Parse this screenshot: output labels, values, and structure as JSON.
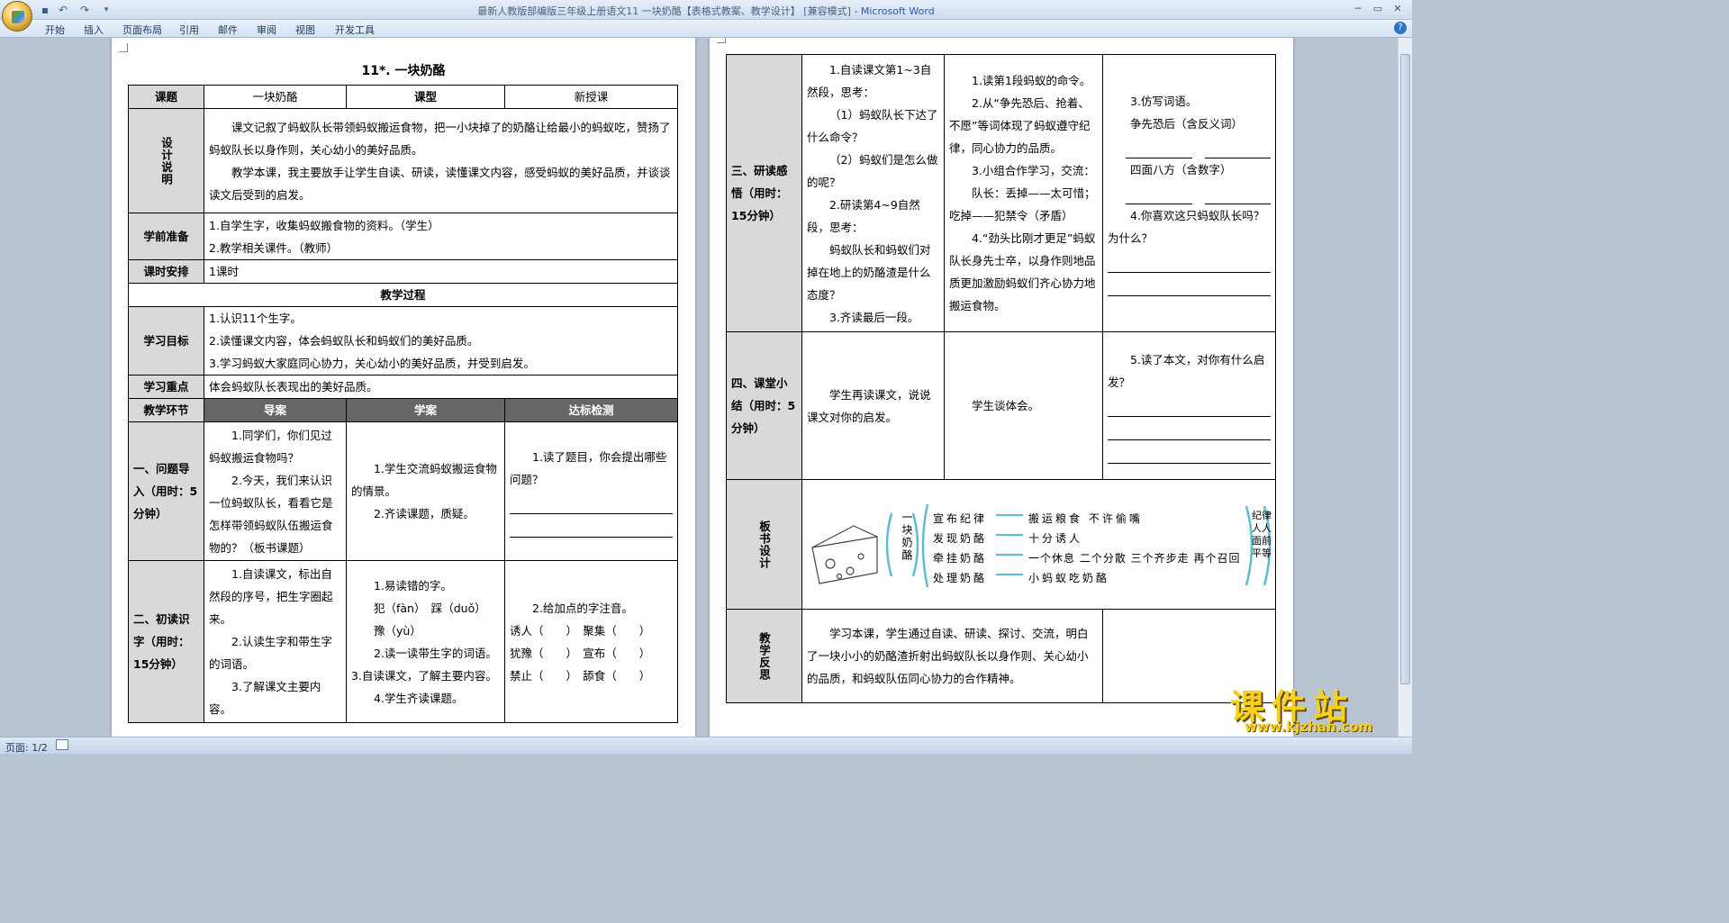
{
  "window": {
    "title": "最新人教版部编版三年级上册语文11 一块奶酪【表格式教案、教学设计】 [兼容模式] - ",
    "app": "Microsoft Word"
  },
  "ribbon": {
    "tabs": [
      "开始",
      "插入",
      "页面布局",
      "引用",
      "邮件",
      "审阅",
      "视图",
      "开发工具"
    ]
  },
  "status": {
    "page": "页面: 1/2"
  },
  "doc": {
    "title": "11*. 一块奶酪",
    "r1": {
      "k1": "课题",
      "v1": "一块奶酪",
      "k2": "课型",
      "v2": "新授课"
    },
    "design": {
      "label": "设计说明",
      "p1": "课文记叙了蚂蚁队长带领蚂蚁搬运食物，把一小块掉了的奶酪让给最小的蚂蚁吃，赞扬了蚂蚁队长以身作则，关心幼小的美好品质。",
      "p2": "教学本课，我主要放手让学生自读、研读，读懂课文内容，感受蚂蚁的美好品质，并谈谈读文后受到的启发。"
    },
    "prep": {
      "label": "学前准备",
      "l1": "1.自学生字，收集蚂蚁搬食物的资料。（学生）",
      "l2": "2.教学相关课件。（教师）"
    },
    "hours": {
      "label": "课时安排",
      "v": "1课时"
    },
    "process": "教学过程",
    "goals": {
      "label": "学习目标",
      "l1": "1.认识11个生字。",
      "l2": "2.读懂课文内容，体会蚂蚁队长和蚂蚁们的美好品质。",
      "l3": "3.学习蚂蚁大家庭同心协力，关心幼小的美好品质，并受到启发。"
    },
    "key": {
      "label": "学习重点",
      "v": "体会蚂蚁队长表现出的美好品质。"
    },
    "hdr": {
      "a": "教学环节",
      "b": "导案",
      "c": "学案",
      "d": "达标检测"
    },
    "s1": {
      "label": "一、问题导入（用时：5分钟）",
      "g1": "1.同学们，你们见过蚂蚁搬运食物吗？",
      "g2": "2.今天，我们来认识一位蚂蚁队长，看看它是怎样带领蚂蚁队伍搬运食物的？（板书课题）",
      "x1": "1.学生交流蚂蚁搬运食物的情景。",
      "x2": "2.齐读课题，质疑。",
      "d1": "1.读了题目，你会提出哪些问题？"
    },
    "s2": {
      "label": "二、初读识字（用时：15分钟）",
      "g1": "1.自读课文，标出自然段的序号，把生字圈起来。",
      "g2": "2.认读生字和带生字的词语。",
      "g3": "3.了解课文主要内容。",
      "x1": "1.易读错的字。",
      "x2": "犯（fàn）　踩（duǒ）",
      "x3": "豫（yù）",
      "x4": "2.读一读带生字的词语。",
      "x5": "3.自读课文，了解主要内容。",
      "x6": "4.学生齐读课题。",
      "d1": "2.给加点的字注音。",
      "d2": "诱人（　　）　聚集（　　）",
      "d3": "犹豫（　　）　宣布（　　）",
      "d4": "禁止（　　）　舔食（　　）"
    },
    "s3": {
      "label": "三、研读感悟（用时：15分钟）",
      "g1": "1.自读课文第1~3自然段，思考：",
      "g2": "（1）蚂蚁队长下达了什么命令？",
      "g3": "（2）蚂蚁们是怎么做的呢？",
      "g4": "2.研读第4~9自然段，思考：",
      "g5": "蚂蚁队长和蚂蚁们对掉在地上的奶酪渣是什么态度？",
      "g6": "3.齐读最后一段。",
      "x1": "1.读第1段蚂蚁的命令。",
      "x2": "2.从“争先恐后、抢着、不愿”等词体现了蚂蚁遵守纪律，同心协力的品质。",
      "x3": "3.小组合作学习，交流：",
      "x4": "队长：丢掉——太可惜；吃掉——犯禁令（矛盾）",
      "x5": "4.“劲头比刚才更足”蚂蚁队长身先士卒，以身作则地品质更加激励蚂蚁们齐心协力地搬运食物。",
      "d1": "3.仿写词语。",
      "d2": "争先恐后（含反义词）",
      "d3": "四面八方（含数字）",
      "d4": "4.你喜欢这只蚂蚁队长吗？为什么？"
    },
    "s4": {
      "label": "四、课堂小结（用时：5分钟）",
      "g1": "学生再读课文，说说课文对你的启发。",
      "x1": "学生谈体会。",
      "d1": "5.读了本文，对你有什么启发？"
    },
    "board": {
      "label": "板书设计",
      "title": "一块奶酪",
      "rows": [
        {
          "a": "宣布纪律",
          "b": "搬运粮食 不许偷嘴"
        },
        {
          "a": "发现奶酪",
          "b": "十分诱人"
        },
        {
          "a": "牵挂奶酪",
          "b": "一个休息 二个分散 三个齐步走 再个召回"
        },
        {
          "a": "处理奶酪",
          "b": "小蚂蚁吃奶酪"
        }
      ],
      "side": "纪律人人面前平等"
    },
    "reflect": {
      "label": "教学反思",
      "v": "学习本课，学生通过自读、研读、探讨、交流，明白了一块小小的奶酪渣折射出蚂蚁队长以身作则、关心幼小的品质，和蚂蚁队伍同心协力的合作精神。"
    }
  },
  "watermark": {
    "cn": "课件站",
    "url": "www.kjzhan.com"
  }
}
